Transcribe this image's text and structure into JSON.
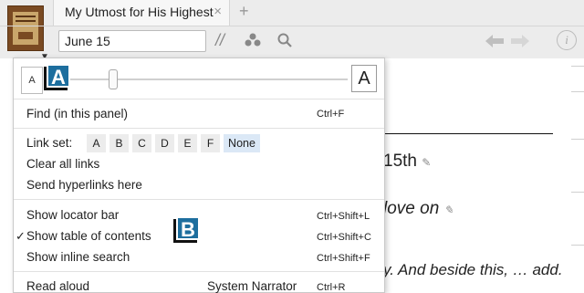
{
  "tab": {
    "title": "My Utmost for His Highest",
    "close": "×",
    "new_tab": "+"
  },
  "toolbar": {
    "location_value": "June 15",
    "parallel_icon": "//",
    "people_icon": "●",
    "search_icon": "⚲",
    "back_icon": "◀",
    "forward_icon": "▶",
    "info_icon": "i"
  },
  "document": {
    "line1": "15th",
    "line2": "love on",
    "line3": "y. And beside this, … add."
  },
  "menu": {
    "font_small": "A",
    "font_large": "A",
    "badge_a": "A",
    "badge_b": "B",
    "find_label": "Find (in this panel)",
    "find_shortcut": "Ctrl+F",
    "link_set_label": "Link set:",
    "link_letters": [
      "A",
      "B",
      "C",
      "D",
      "E",
      "F"
    ],
    "link_none": "None",
    "clear_links": "Clear all links",
    "send_hyperlinks": "Send hyperlinks here",
    "show_locator": "Show locator bar",
    "show_locator_shortcut": "Ctrl+Shift+L",
    "check_mark": "✓",
    "show_toc": "Show table of contents",
    "show_toc_shortcut": "Ctrl+Shift+C",
    "show_inline_search": "Show inline search",
    "show_inline_search_shortcut": "Ctrl+Shift+F",
    "read_aloud": "Read aloud",
    "read_aloud_voice": "System Narrator",
    "read_aloud_shortcut": "Ctrl+R"
  }
}
